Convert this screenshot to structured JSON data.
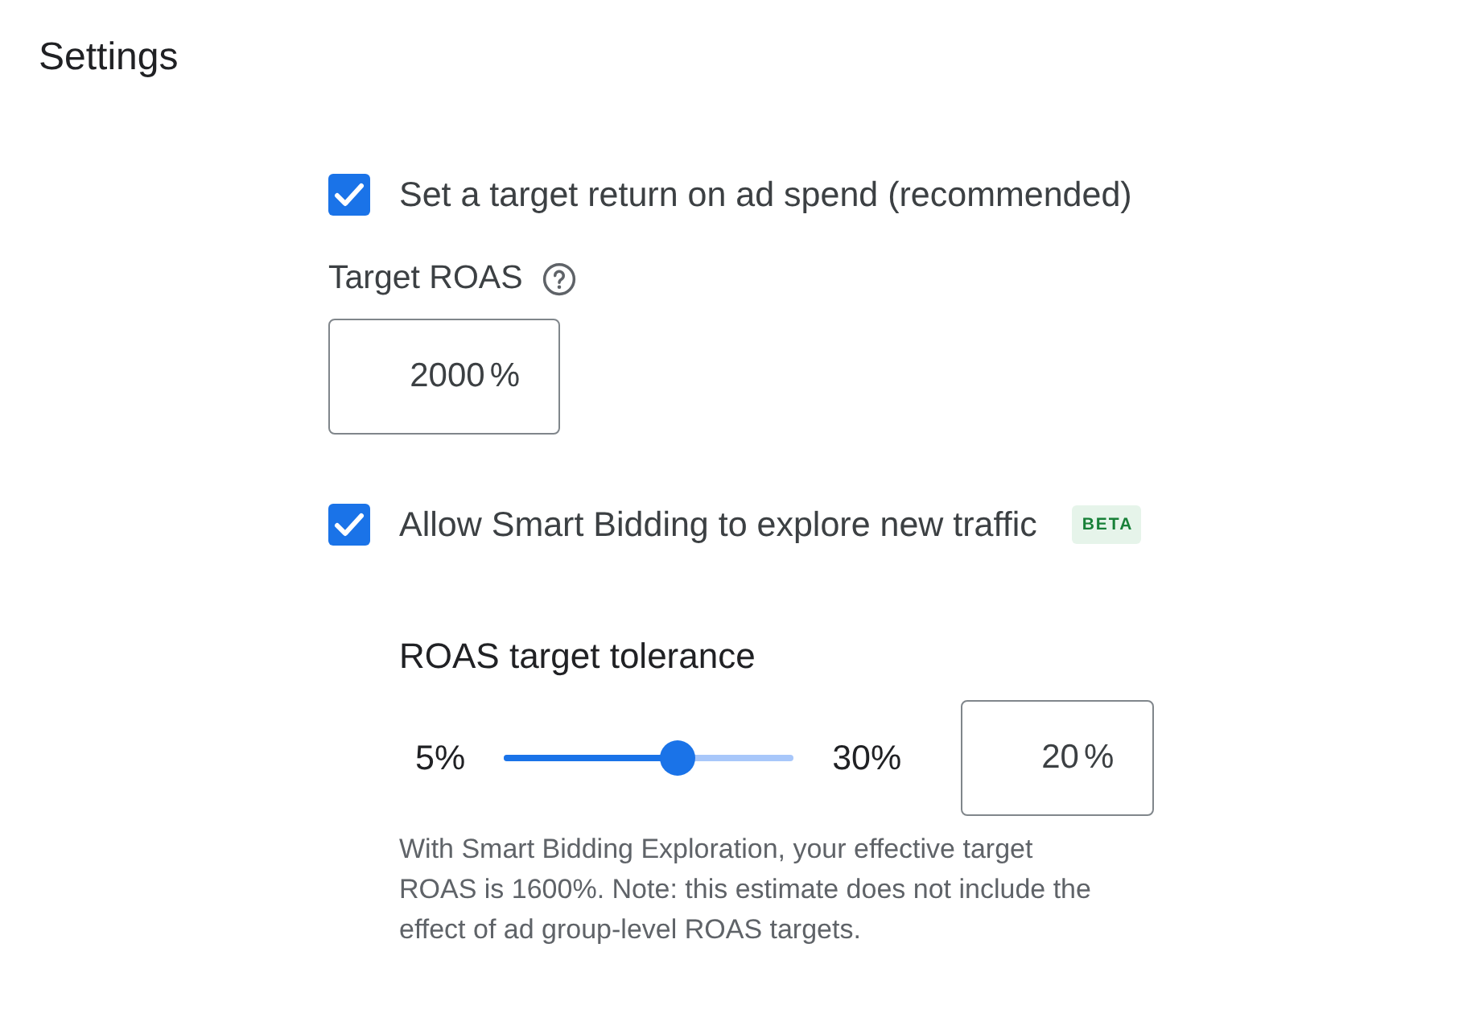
{
  "page": {
    "title": "Settings"
  },
  "target_option": {
    "label": "Set a target return on ad spend (recommended)",
    "checked": true
  },
  "target_field": {
    "label": "Target ROAS",
    "value": "2000",
    "suffix": "%"
  },
  "explore_option": {
    "label": "Allow Smart Bidding to explore new traffic",
    "checked": true,
    "badge": "BETA"
  },
  "tolerance": {
    "heading": "ROAS target tolerance",
    "min_label": "5%",
    "max_label": "30%",
    "level": 0.6,
    "value": "20",
    "suffix": "%",
    "help_text": "With Smart Bidding Exploration, your effective target ROAS is 1600%. Note: this estimate does not include the effect of ad group-level ROAS targets."
  }
}
